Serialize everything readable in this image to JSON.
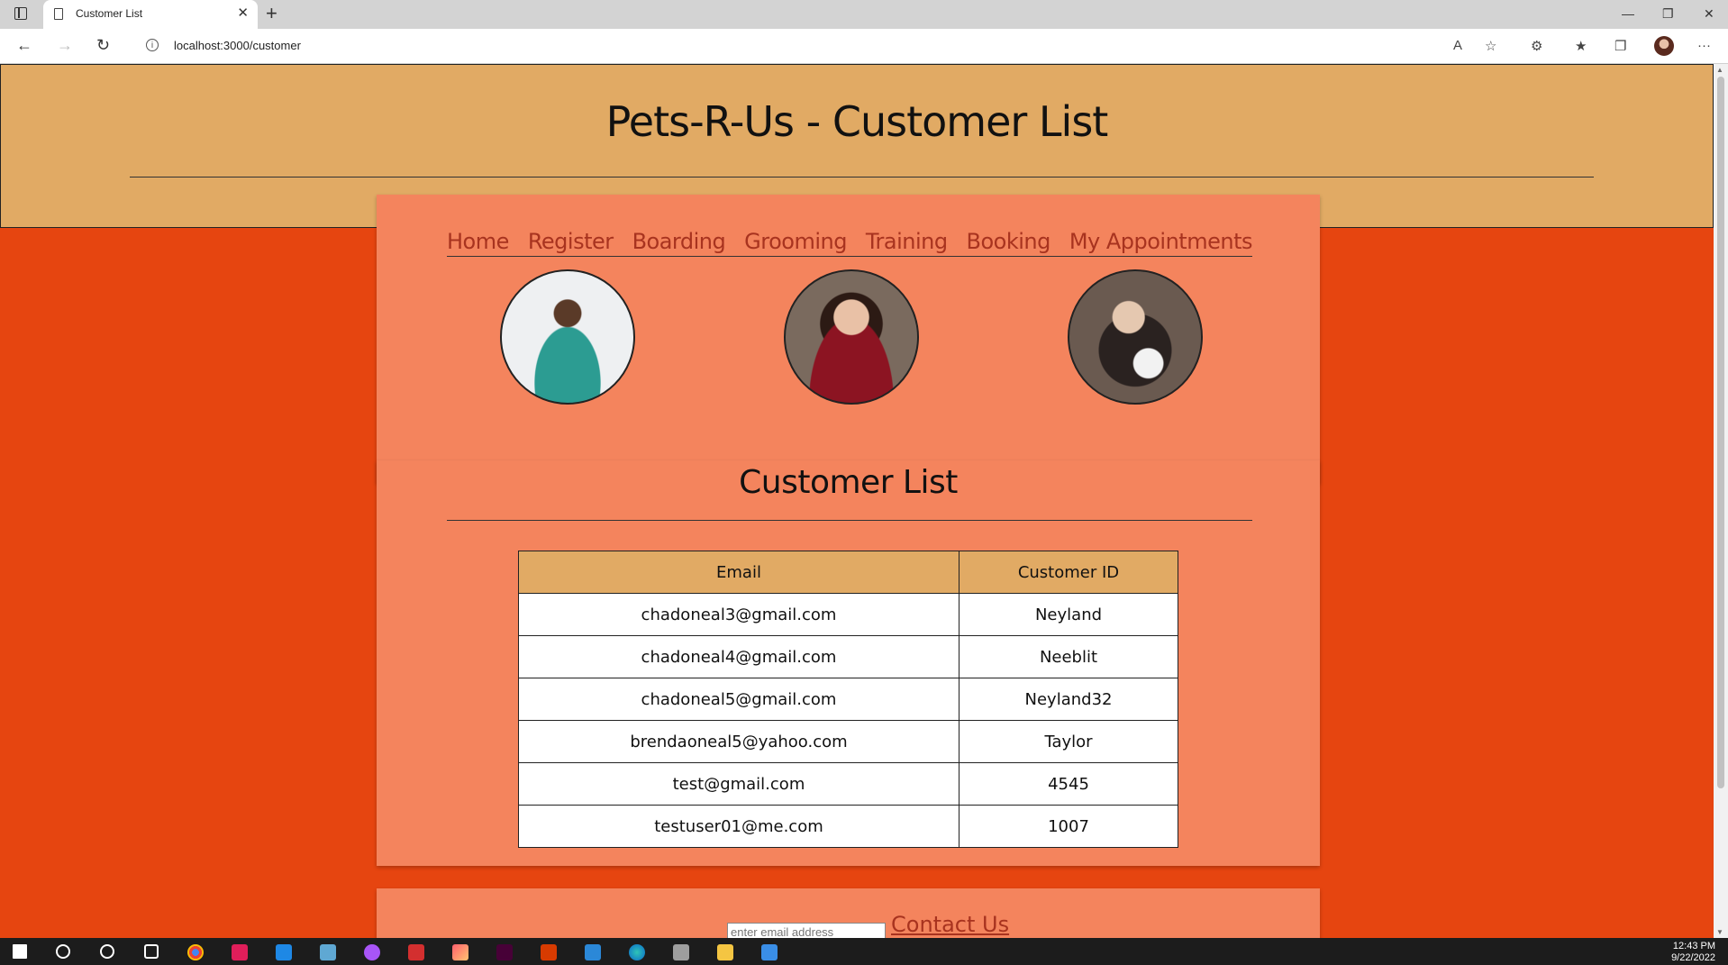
{
  "browser": {
    "tab_title": "Customer List",
    "tab_close": "✕",
    "new_tab": "+",
    "url": "localhost:3000/customer",
    "controls": {
      "minimize": "—",
      "restore": "❐",
      "close": "✕"
    },
    "more": "···"
  },
  "header": {
    "title": "Pets-R-Us - Customer List"
  },
  "nav": {
    "items": [
      {
        "label": "Home"
      },
      {
        "label": "Register"
      },
      {
        "label": "Boarding"
      },
      {
        "label": "Grooming"
      },
      {
        "label": "Training"
      },
      {
        "label": "Booking"
      },
      {
        "label": "My Appointments"
      }
    ]
  },
  "customer_list": {
    "title": "Customer List",
    "columns": [
      "Email",
      "Customer ID"
    ],
    "rows": [
      {
        "email": "chadoneal3@gmail.com",
        "id": "Neyland"
      },
      {
        "email": "chadoneal4@gmail.com",
        "id": "Neeblit"
      },
      {
        "email": "chadoneal5@gmail.com",
        "id": "Neyland32"
      },
      {
        "email": "brendaoneal5@yahoo.com",
        "id": "Taylor"
      },
      {
        "email": "test@gmail.com",
        "id": "4545"
      },
      {
        "email": "testuser01@me.com",
        "id": "1007"
      }
    ]
  },
  "footer": {
    "email_placeholder": "enter email address",
    "contact_label": "Contact Us"
  },
  "taskbar": {
    "time": "12:43 PM",
    "date": "9/22/2022"
  },
  "colors": {
    "page_bg": "#e64510",
    "header_bg": "#e1aa64",
    "card_bg": "#f4845d",
    "link": "#a8331f"
  }
}
